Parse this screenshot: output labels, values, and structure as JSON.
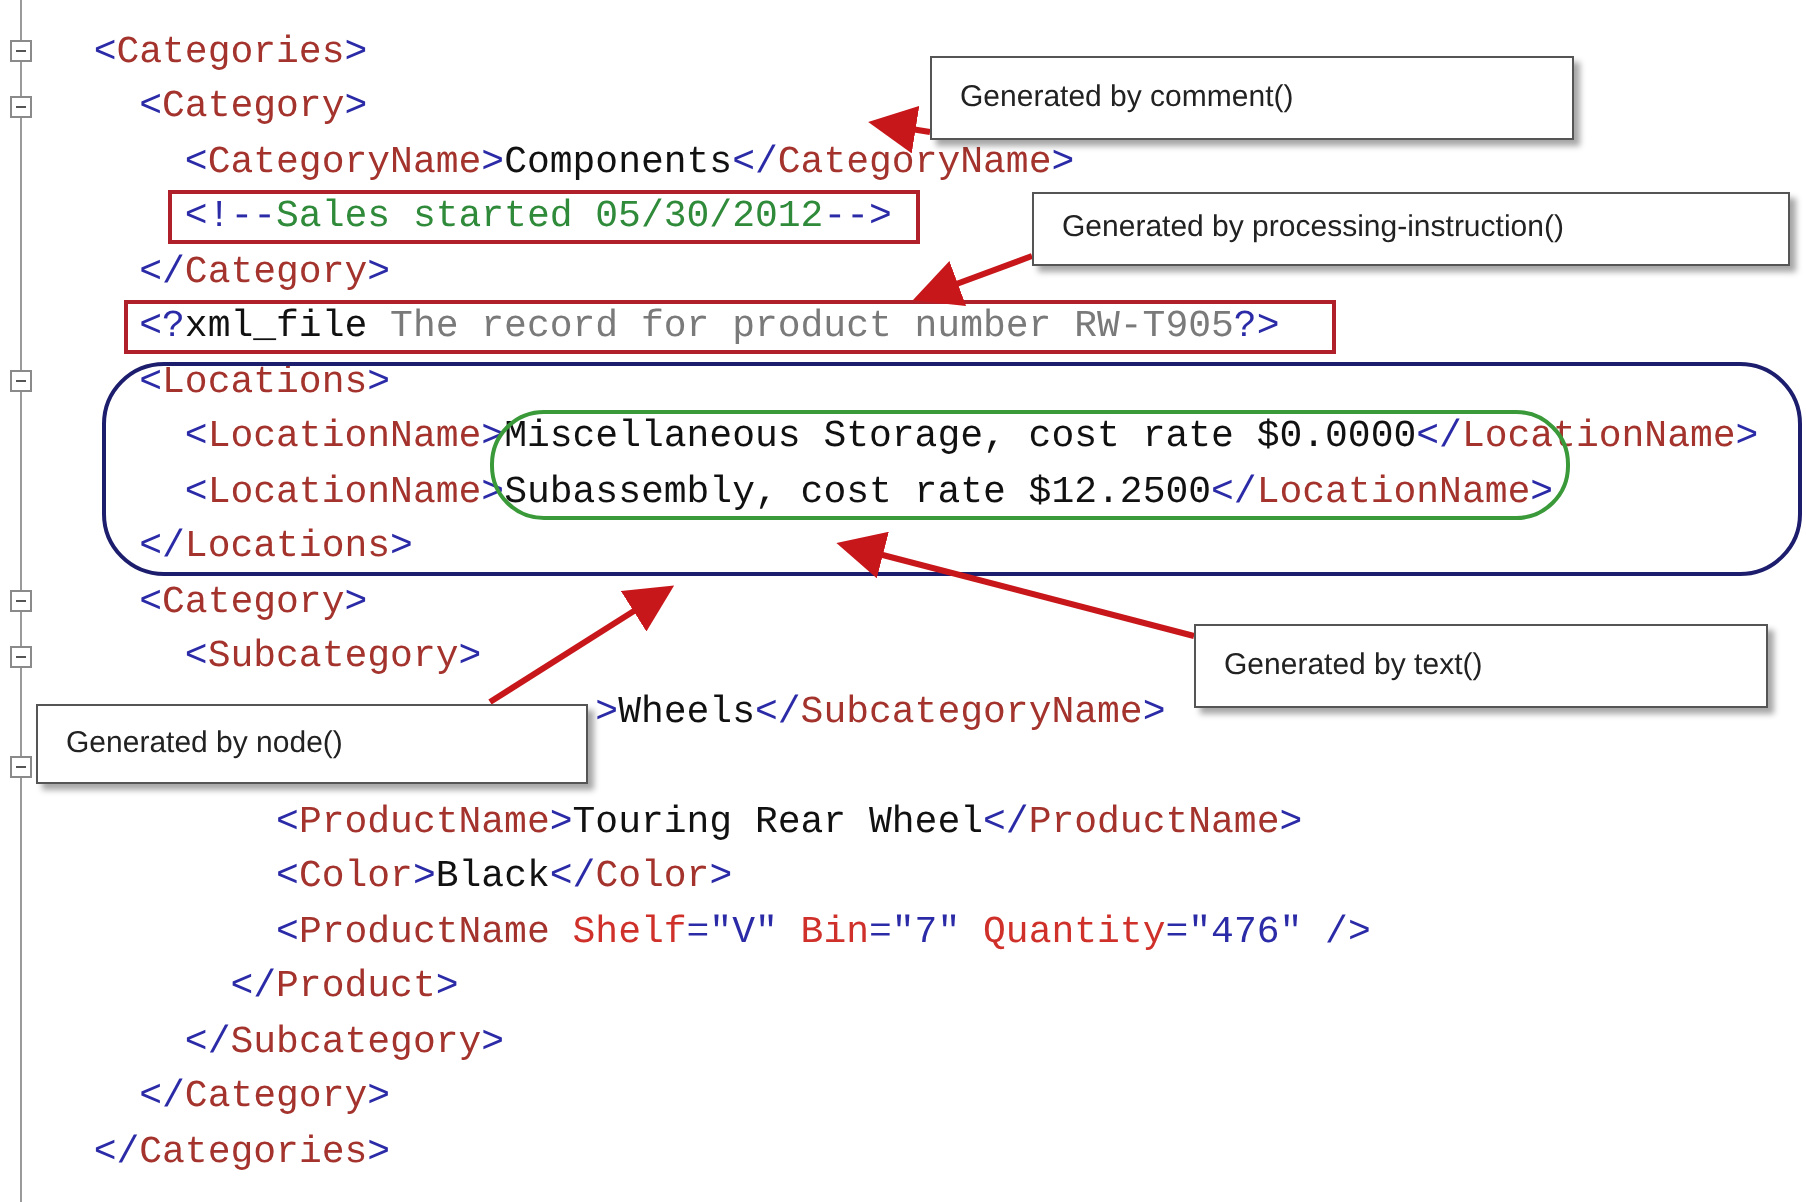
{
  "editor": {
    "lines": [
      {
        "collapsible": true,
        "segments": [
          {
            "kind": "punct",
            "text": "  <"
          },
          {
            "kind": "tag",
            "text": "Categories"
          },
          {
            "kind": "punct",
            "text": ">"
          }
        ]
      },
      {
        "collapsible": true,
        "segments": [
          {
            "kind": "punct",
            "text": "    <"
          },
          {
            "kind": "tag",
            "text": "Category"
          },
          {
            "kind": "punct",
            "text": ">"
          }
        ]
      },
      {
        "collapsible": false,
        "segments": [
          {
            "kind": "punct",
            "text": "      <"
          },
          {
            "kind": "tag",
            "text": "CategoryName"
          },
          {
            "kind": "punct",
            "text": ">"
          },
          {
            "kind": "text",
            "text": "Components"
          },
          {
            "kind": "punct",
            "text": "</"
          },
          {
            "kind": "tag",
            "text": "CategoryName"
          },
          {
            "kind": "punct",
            "text": ">"
          }
        ]
      },
      {
        "collapsible": false,
        "segments": [
          {
            "kind": "punct",
            "text": "      <!--"
          },
          {
            "kind": "comment",
            "text": "Sales started 05/30/2012"
          },
          {
            "kind": "punct",
            "text": "-->"
          }
        ]
      },
      {
        "collapsible": false,
        "segments": [
          {
            "kind": "punct",
            "text": "    </"
          },
          {
            "kind": "tag",
            "text": "Category"
          },
          {
            "kind": "punct",
            "text": ">"
          }
        ]
      },
      {
        "collapsible": false,
        "segments": [
          {
            "kind": "punct",
            "text": "    <?"
          },
          {
            "kind": "text",
            "text": "xml_file"
          },
          {
            "kind": "pi",
            "text": " The record for product number RW-T905"
          },
          {
            "kind": "punct",
            "text": "?>"
          }
        ]
      },
      {
        "collapsible": true,
        "segments": [
          {
            "kind": "punct",
            "text": "    <"
          },
          {
            "kind": "tag",
            "text": "Locations"
          },
          {
            "kind": "punct",
            "text": ">"
          }
        ]
      },
      {
        "collapsible": false,
        "segments": [
          {
            "kind": "punct",
            "text": "      <"
          },
          {
            "kind": "tag",
            "text": "LocationName"
          },
          {
            "kind": "punct",
            "text": ">"
          },
          {
            "kind": "text",
            "text": "Miscellaneous Storage, cost rate $0.0000"
          },
          {
            "kind": "punct",
            "text": "</"
          },
          {
            "kind": "tag",
            "text": "LocationName"
          },
          {
            "kind": "punct",
            "text": ">"
          }
        ]
      },
      {
        "collapsible": false,
        "segments": [
          {
            "kind": "punct",
            "text": "      <"
          },
          {
            "kind": "tag",
            "text": "LocationName"
          },
          {
            "kind": "punct",
            "text": ">"
          },
          {
            "kind": "text",
            "text": "Subassembly, cost rate $12.2500"
          },
          {
            "kind": "punct",
            "text": "</"
          },
          {
            "kind": "tag",
            "text": "LocationName"
          },
          {
            "kind": "punct",
            "text": ">"
          }
        ]
      },
      {
        "collapsible": false,
        "segments": [
          {
            "kind": "punct",
            "text": "    </"
          },
          {
            "kind": "tag",
            "text": "Locations"
          },
          {
            "kind": "punct",
            "text": ">"
          }
        ]
      },
      {
        "collapsible": true,
        "segments": [
          {
            "kind": "punct",
            "text": "    <"
          },
          {
            "kind": "tag",
            "text": "Category"
          },
          {
            "kind": "punct",
            "text": ">"
          }
        ]
      },
      {
        "collapsible": true,
        "segments": [
          {
            "kind": "punct",
            "text": "      <"
          },
          {
            "kind": "tag",
            "text": "Subcategory"
          },
          {
            "kind": "punct",
            "text": ">"
          }
        ]
      },
      {
        "collapsible": false,
        "segments": [
          {
            "kind": "punct",
            "text": "                        >"
          },
          {
            "kind": "text",
            "text": "Wheels"
          },
          {
            "kind": "punct",
            "text": "</"
          },
          {
            "kind": "tag",
            "text": "SubcategoryName"
          },
          {
            "kind": "punct",
            "text": ">"
          }
        ]
      },
      {
        "collapsible": true
      },
      {
        "collapsible": false,
        "segments": [
          {
            "kind": "punct",
            "text": "          <"
          },
          {
            "kind": "tag",
            "text": "ProductName"
          },
          {
            "kind": "punct",
            "text": ">"
          },
          {
            "kind": "text",
            "text": "Touring Rear Wheel"
          },
          {
            "kind": "punct",
            "text": "</"
          },
          {
            "kind": "tag",
            "text": "ProductName"
          },
          {
            "kind": "punct",
            "text": ">"
          }
        ]
      },
      {
        "collapsible": false,
        "segments": [
          {
            "kind": "punct",
            "text": "          <"
          },
          {
            "kind": "tag",
            "text": "Color"
          },
          {
            "kind": "punct",
            "text": ">"
          },
          {
            "kind": "text",
            "text": "Black"
          },
          {
            "kind": "punct",
            "text": "</"
          },
          {
            "kind": "tag",
            "text": "Color"
          },
          {
            "kind": "punct",
            "text": ">"
          }
        ]
      },
      {
        "collapsible": false,
        "segments": [
          {
            "kind": "punct",
            "text": "          <"
          },
          {
            "kind": "tag",
            "text": "ProductName"
          },
          {
            "kind": "attr",
            "text": " Shelf"
          },
          {
            "kind": "punct",
            "text": "=\"V\""
          },
          {
            "kind": "attr",
            "text": " Bin"
          },
          {
            "kind": "punct",
            "text": "=\"7\""
          },
          {
            "kind": "attr",
            "text": " Quantity"
          },
          {
            "kind": "punct",
            "text": "=\"476\" />"
          }
        ]
      },
      {
        "collapsible": false,
        "segments": [
          {
            "kind": "punct",
            "text": "        </"
          },
          {
            "kind": "tag",
            "text": "Product"
          },
          {
            "kind": "punct",
            "text": ">"
          }
        ]
      },
      {
        "collapsible": false,
        "segments": [
          {
            "kind": "punct",
            "text": "      </"
          },
          {
            "kind": "tag",
            "text": "Subcategory"
          },
          {
            "kind": "punct",
            "text": ">"
          }
        ]
      },
      {
        "collapsible": false,
        "segments": [
          {
            "kind": "punct",
            "text": "    </"
          },
          {
            "kind": "tag",
            "text": "Category"
          },
          {
            "kind": "punct",
            "text": ">"
          }
        ]
      },
      {
        "collapsible": false,
        "segments": [
          {
            "kind": "punct",
            "text": "  </"
          },
          {
            "kind": "tag",
            "text": "Categories"
          },
          {
            "kind": "punct",
            "text": ">"
          }
        ]
      }
    ]
  },
  "callouts": [
    {
      "text": "Generated by comment()"
    },
    {
      "text": "Generated by processing-instruction()"
    },
    {
      "text": "Generated by text()"
    },
    {
      "text": "Generated by node()"
    }
  ]
}
